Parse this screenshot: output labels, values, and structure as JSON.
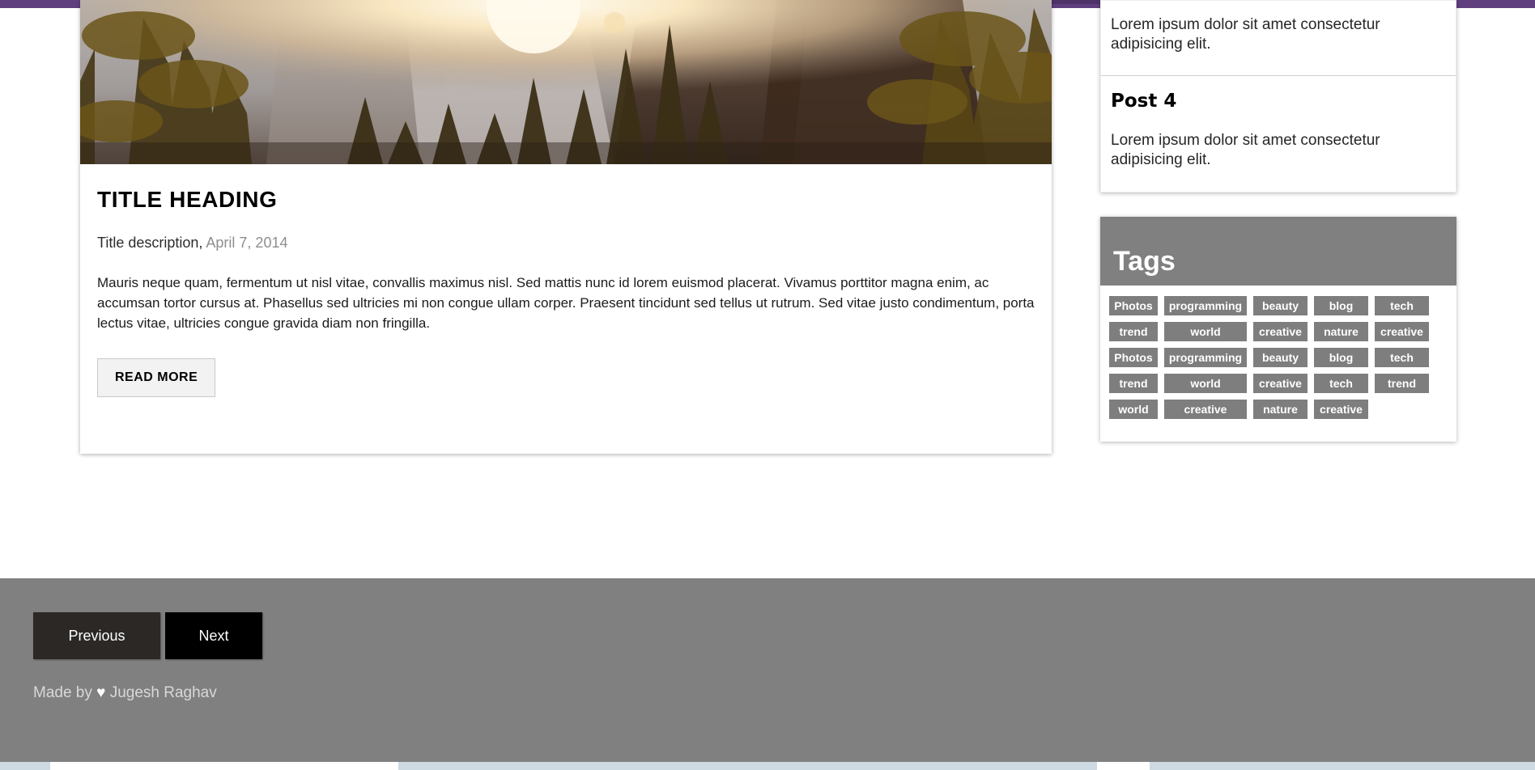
{
  "theme": {
    "topbar_color": "#5f3f7e",
    "footer_color": "#808080",
    "tag_chip_color": "#7e7e7e",
    "next_button_color": "#000000",
    "previous_button_color": "#2b2826"
  },
  "article": {
    "hero_image_alt": "sunset-forest-mountain-photo",
    "title": "TITLE HEADING",
    "description_label": "Title description,",
    "date": "April 7, 2014",
    "body": "Mauris neque quam, fermentum ut nisl vitae, convallis maximus nisl. Sed mattis nunc id lorem euismod placerat. Vivamus porttitor magna enim, ac accumsan tortor cursus at. Phasellus sed ultricies mi non congue ullam corper. Praesent tincidunt sed tellus ut rutrum. Sed vitae justo condimentum, porta lectus vitae, ultricies congue gravida diam non fringilla.",
    "read_more_label": "READ MORE"
  },
  "sidebar": {
    "posts": [
      {
        "title": "",
        "excerpt": "Lorem ipsum dolor sit amet consectetur adipisicing elit."
      },
      {
        "title": "Post 4",
        "excerpt": "Lorem ipsum dolor sit amet consectetur adipisicing elit."
      }
    ],
    "tags_panel": {
      "title": "Tags",
      "rows": [
        [
          "Photos",
          "programming",
          "beauty",
          "blog",
          "tech"
        ],
        [
          "trend",
          "world",
          "creative",
          "nature",
          "creative"
        ],
        [
          "Photos",
          "programming",
          "beauty",
          "blog",
          "tech"
        ],
        [
          "trend",
          "world",
          "creative",
          "tech",
          "trend"
        ],
        [
          "world",
          "creative",
          "nature",
          "creative"
        ]
      ]
    }
  },
  "footer": {
    "previous_label": "Previous",
    "next_label": "Next",
    "credit_prefix": "Made by",
    "credit_heart": "♥",
    "credit_author": "Jugesh Raghav"
  }
}
